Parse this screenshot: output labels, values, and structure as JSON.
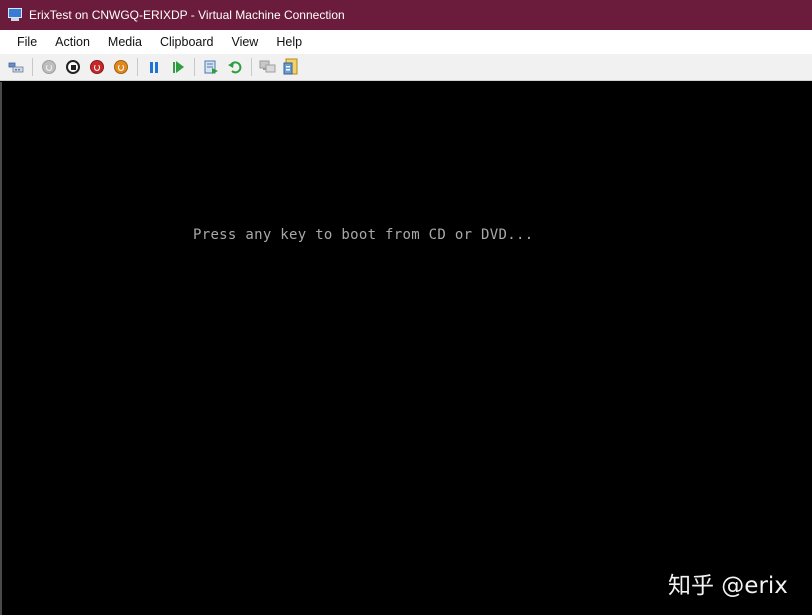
{
  "window": {
    "title": "ErixTest on CNWGQ-ERIXDP - Virtual Machine Connection",
    "icon": "virtual-machine-connection-icon",
    "title_color": "#6b1c3c"
  },
  "menu": {
    "items": [
      "File",
      "Action",
      "Media",
      "Clipboard",
      "View",
      "Help"
    ]
  },
  "toolbar": {
    "buttons": [
      {
        "name": "ctrl-alt-del-icon"
      },
      {
        "name": "start-icon",
        "state": "disabled"
      },
      {
        "name": "turn-off-icon"
      },
      {
        "name": "shut-down-icon"
      },
      {
        "name": "save-icon"
      },
      {
        "name": "pause-icon"
      },
      {
        "name": "resume-icon"
      },
      {
        "name": "checkpoint-icon"
      },
      {
        "name": "revert-icon"
      },
      {
        "name": "enhanced-session-icon",
        "state": "disabled"
      },
      {
        "name": "share-icon"
      }
    ]
  },
  "screen": {
    "boot_message": "Press any key to boot from CD or DVD...",
    "background": "#000000",
    "text_color": "#a8a8a8"
  },
  "watermark": {
    "text": "知乎 @erix"
  }
}
